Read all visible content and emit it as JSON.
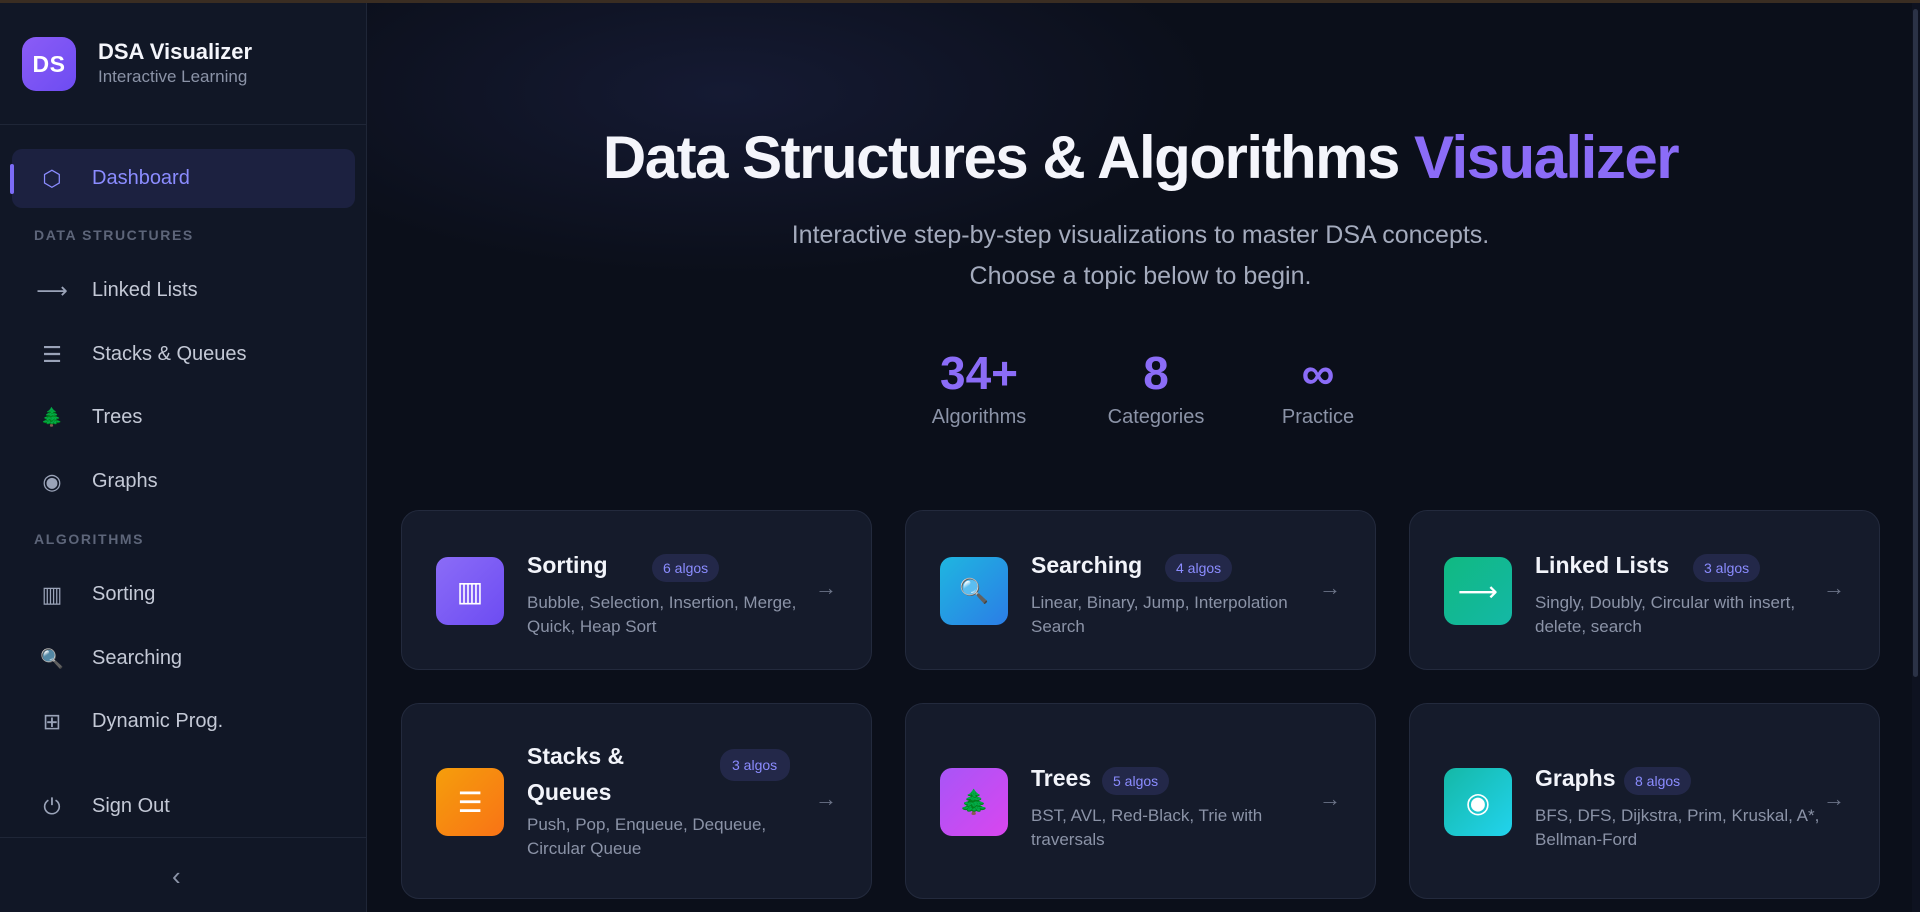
{
  "brand": {
    "logo": "DS",
    "title": "DSA Visualizer",
    "subtitle": "Interactive Learning"
  },
  "sidebar": {
    "dashboard": {
      "label": "Dashboard",
      "icon": "⬡"
    },
    "section_data_structures": "DATA STRUCTURES",
    "data_structures": [
      {
        "label": "Linked Lists",
        "icon": "⟶"
      },
      {
        "label": "Stacks & Queues",
        "icon": "☰"
      },
      {
        "label": "Trees",
        "icon": "🌲"
      },
      {
        "label": "Graphs",
        "icon": "◉"
      }
    ],
    "section_algorithms": "ALGORITHMS",
    "algorithms": [
      {
        "label": "Sorting",
        "icon": "▥"
      },
      {
        "label": "Searching",
        "icon": "🔍"
      },
      {
        "label": "Dynamic Prog.",
        "icon": "⊞"
      }
    ],
    "sign_out": {
      "label": "Sign Out",
      "icon": "⏻"
    },
    "collapse_icon": "‹"
  },
  "hero": {
    "title_main": "Data Structures & Algorithms ",
    "title_accent": "Visualizer",
    "subtitle_line1": "Interactive step-by-step visualizations to master DSA concepts.",
    "subtitle_line2": "Choose a topic below to begin."
  },
  "stats": [
    {
      "value": "34+",
      "label": "Algorithms"
    },
    {
      "value": "8",
      "label": "Categories"
    },
    {
      "value": "∞",
      "label": "Practice"
    }
  ],
  "cards": [
    {
      "title": "Sorting",
      "badge": "6 algos",
      "desc": "Bubble, Selection, Insertion, Merge, Quick, Heap Sort",
      "icon": "▥",
      "arrow": "→"
    },
    {
      "title": "Searching",
      "badge": "4 algos",
      "desc": "Linear, Binary, Jump, Interpolation Search",
      "icon": "🔍",
      "arrow": "→"
    },
    {
      "title": "Linked Lists",
      "badge": "3 algos",
      "desc": "Singly, Doubly, Circular with insert, delete, search",
      "icon": "⟶",
      "arrow": "→"
    },
    {
      "title": "Stacks & Queues",
      "badge": "3 algos",
      "desc": "Push, Pop, Enqueue, Dequeue, Circular Queue",
      "icon": "☰",
      "arrow": "→"
    },
    {
      "title": "Trees",
      "badge": "5 algos",
      "desc": "BST, AVL, Red-Black, Trie with traversals",
      "icon": "🌲",
      "arrow": "→"
    },
    {
      "title": "Graphs",
      "badge": "8 algos",
      "desc": "BFS, DFS, Dijkstra, Prim, Kruskal, A*, Bellman-Ford",
      "icon": "◉",
      "arrow": "→"
    }
  ],
  "colors": {
    "accent": "#8b6cf7",
    "card_sorting": "#7c5cf6",
    "card_searching": "#1ea5e9",
    "card_linked": "#14b8a6",
    "card_stacks": "#f97316",
    "card_trees": "#c04be6",
    "card_graphs": "#14c4c4"
  }
}
